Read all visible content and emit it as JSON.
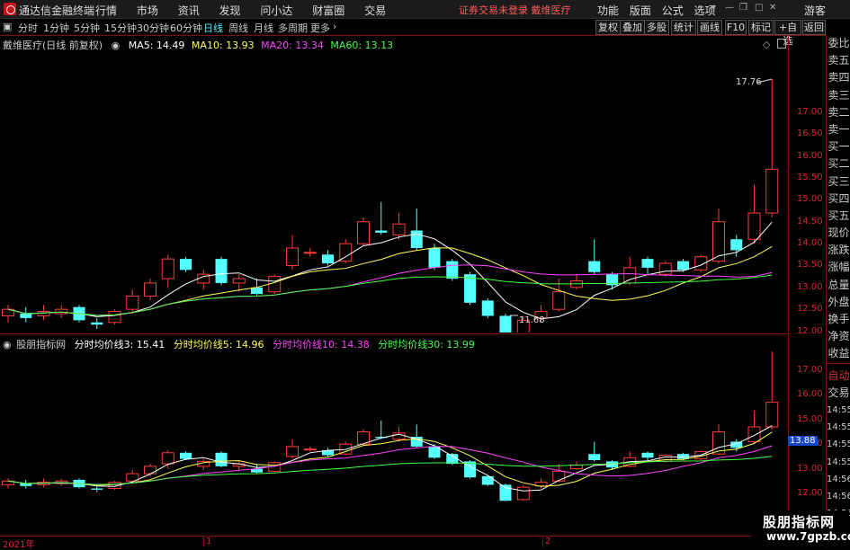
{
  "app": {
    "title": "通达信金融终端",
    "notice": "证券交易未登录   戴维医疗",
    "guest": "游客"
  },
  "menu": [
    "行情",
    "市场",
    "资讯",
    "发现",
    "问小达",
    "财富圈",
    "交易"
  ],
  "right_menu": [
    "功能",
    "版面",
    "公式",
    "选项"
  ],
  "periods": [
    "分时",
    "1分钟",
    "5分钟",
    "15分钟",
    "30分钟",
    "60分钟",
    "日线",
    "周线",
    "月线",
    "多周期",
    "更多"
  ],
  "active_period": "日线",
  "toolbar_buttons": [
    "复权",
    "叠加",
    "多股",
    "统计",
    "画线",
    "F10",
    "标记",
    "+自选",
    "返回"
  ],
  "main_chart": {
    "stock_label": "戴维医疗(日线 前复权)",
    "ma": [
      {
        "label": "MA5: 14.49",
        "color": "#ffffff"
      },
      {
        "label": "MA10: 13.93",
        "color": "#ffff55"
      },
      {
        "label": "MA20: 13.34",
        "color": "#ff44ff"
      },
      {
        "label": "MA60: 13.13",
        "color": "#44ff44"
      }
    ],
    "y_ticks": [
      "17.00",
      "16.50",
      "16.00",
      "15.50",
      "15.00",
      "14.50",
      "14.00",
      "13.50",
      "13.00",
      "12.50",
      "12.00"
    ],
    "high_label": "17.76",
    "low_label": "11.68"
  },
  "indicator_chart": {
    "name": "股朋指标网",
    "lines": [
      {
        "label": "分时均价线3: 15.41",
        "color": "#ffffff"
      },
      {
        "label": "分时均价线5: 14.96",
        "color": "#ffff55"
      },
      {
        "label": "分时均价线10: 14.38",
        "color": "#ff44ff"
      },
      {
        "label": "分时均价线30: 13.99",
        "color": "#44ff44"
      }
    ],
    "y_ticks": [
      "17.00",
      "16.00",
      "15.00",
      "14.00",
      "13.00",
      "12.00"
    ],
    "current_value": "13.88"
  },
  "sidebar": [
    "委比",
    "卖五",
    "卖四",
    "卖三",
    "卖二",
    "卖一",
    "买一",
    "买二",
    "买三",
    "买四",
    "买五",
    "现价",
    "涨跌",
    "涨幅",
    "总量",
    "外盘",
    "换手",
    "净资",
    "收益"
  ],
  "sidebar2": [
    "自动",
    "交易"
  ],
  "sidebar2_values": [
    "14:55",
    "14:55",
    "14:55",
    "14:55",
    "14:56",
    "14:56",
    "14:56",
    "14:56",
    "14:56"
  ],
  "time_axis": [
    "2021年",
    "1",
    "2"
  ],
  "watermark": {
    "line1": "股朋指标网",
    "line2": "www.7gpzb.com"
  },
  "chart_data": {
    "type": "candlestick",
    "series": [
      {
        "o": 12.35,
        "c": 12.5,
        "h": 12.6,
        "l": 12.2
      },
      {
        "o": 12.4,
        "c": 12.3,
        "h": 12.55,
        "l": 12.2
      },
      {
        "o": 12.35,
        "c": 12.45,
        "h": 12.6,
        "l": 12.25
      },
      {
        "o": 12.4,
        "c": 12.5,
        "h": 12.6,
        "l": 12.3
      },
      {
        "o": 12.55,
        "c": 12.25,
        "h": 12.6,
        "l": 12.2
      },
      {
        "o": 12.2,
        "c": 12.15,
        "h": 12.3,
        "l": 12.05
      },
      {
        "o": 12.2,
        "c": 12.45,
        "h": 12.5,
        "l": 12.15
      },
      {
        "o": 12.5,
        "c": 12.8,
        "h": 12.95,
        "l": 12.4
      },
      {
        "o": 12.8,
        "c": 13.1,
        "h": 13.2,
        "l": 12.7
      },
      {
        "o": 13.2,
        "c": 13.65,
        "h": 13.75,
        "l": 13.0
      },
      {
        "o": 13.65,
        "c": 13.4,
        "h": 13.7,
        "l": 13.35
      },
      {
        "o": 13.1,
        "c": 13.3,
        "h": 13.4,
        "l": 12.95
      },
      {
        "o": 13.65,
        "c": 13.1,
        "h": 13.7,
        "l": 13.05
      },
      {
        "o": 13.1,
        "c": 13.2,
        "h": 13.3,
        "l": 12.9
      },
      {
        "o": 13.0,
        "c": 12.85,
        "h": 13.2,
        "l": 12.8
      },
      {
        "o": 12.9,
        "c": 13.25,
        "h": 13.3,
        "l": 12.85
      },
      {
        "o": 13.5,
        "c": 13.9,
        "h": 14.2,
        "l": 13.4
      },
      {
        "o": 13.8,
        "c": 13.8,
        "h": 13.9,
        "l": 13.7
      },
      {
        "o": 13.75,
        "c": 13.55,
        "h": 13.85,
        "l": 13.5
      },
      {
        "o": 13.6,
        "c": 14.0,
        "h": 14.1,
        "l": 13.55
      },
      {
        "o": 14.0,
        "c": 14.5,
        "h": 14.6,
        "l": 13.95
      },
      {
        "o": 14.3,
        "c": 14.25,
        "h": 14.95,
        "l": 14.2
      },
      {
        "o": 14.2,
        "c": 14.45,
        "h": 14.7,
        "l": 14.1
      },
      {
        "o": 14.3,
        "c": 13.9,
        "h": 14.8,
        "l": 13.85
      },
      {
        "o": 13.9,
        "c": 13.45,
        "h": 14.0,
        "l": 13.4
      },
      {
        "o": 13.6,
        "c": 13.2,
        "h": 13.65,
        "l": 13.15
      },
      {
        "o": 13.3,
        "c": 12.65,
        "h": 13.35,
        "l": 12.6
      },
      {
        "o": 12.7,
        "c": 12.35,
        "h": 12.75,
        "l": 12.3
      },
      {
        "o": 12.35,
        "c": 11.7,
        "h": 12.4,
        "l": 11.68
      },
      {
        "o": 11.75,
        "c": 12.25,
        "h": 12.35,
        "l": 11.7
      },
      {
        "o": 12.3,
        "c": 12.45,
        "h": 12.6,
        "l": 12.2
      },
      {
        "o": 12.5,
        "c": 12.9,
        "h": 13.2,
        "l": 12.45
      },
      {
        "o": 13.0,
        "c": 13.15,
        "h": 13.3,
        "l": 12.95
      },
      {
        "o": 13.6,
        "c": 13.35,
        "h": 14.1,
        "l": 13.3
      },
      {
        "o": 13.3,
        "c": 13.05,
        "h": 13.35,
        "l": 12.95
      },
      {
        "o": 13.1,
        "c": 13.45,
        "h": 13.7,
        "l": 13.05
      },
      {
        "o": 13.65,
        "c": 13.45,
        "h": 13.7,
        "l": 13.3
      },
      {
        "o": 13.3,
        "c": 13.55,
        "h": 13.6,
        "l": 13.25
      },
      {
        "o": 13.6,
        "c": 13.4,
        "h": 13.65,
        "l": 13.35
      },
      {
        "o": 13.4,
        "c": 13.7,
        "h": 13.75,
        "l": 13.35
      },
      {
        "o": 13.6,
        "c": 14.5,
        "h": 14.8,
        "l": 13.55
      },
      {
        "o": 14.1,
        "c": 13.85,
        "h": 14.2,
        "l": 13.7
      },
      {
        "o": 14.1,
        "c": 14.7,
        "h": 15.35,
        "l": 14.0
      },
      {
        "o": 14.7,
        "c": 15.7,
        "h": 17.76,
        "l": 14.6
      }
    ]
  }
}
